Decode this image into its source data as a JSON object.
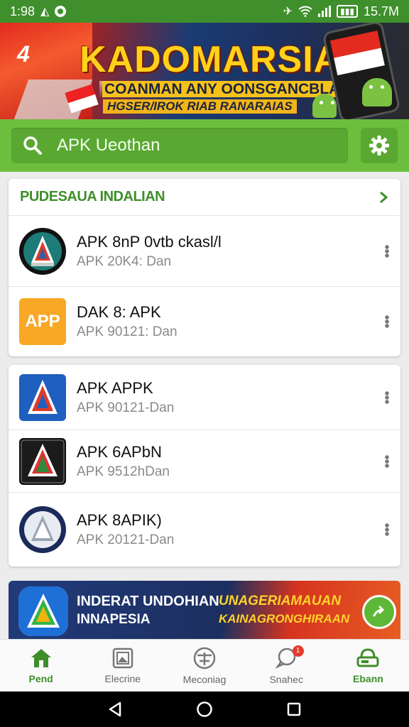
{
  "status_bar": {
    "time": "1:98",
    "right_text": "15.7M",
    "icons": [
      "notification-icon",
      "dot-icon",
      "nfc-icon",
      "wifi-icon",
      "signal-icon",
      "battery-icon"
    ]
  },
  "banner": {
    "logo_mark": "4",
    "title": "KADOMARSIA",
    "line1": "COANMAN ANY OONSGANCBLAS",
    "line2": "HGSER/IROK RIAB RANARAIAS"
  },
  "search": {
    "value": "APK Ueothan",
    "icons": [
      "search-icon",
      "gear-icon"
    ]
  },
  "section1": {
    "title": "PUDESAUA INDALIAN",
    "items": [
      {
        "name": "APK 8nP 0vtb ckasl/l",
        "meta": "APK  20K4: Dan",
        "icon": "apk-logo-dark-circle"
      },
      {
        "name": "DAK 8: APK",
        "meta": "APK  90121: Dan",
        "icon_text": "APP",
        "icon": "app-orange-square"
      }
    ]
  },
  "section2": {
    "items": [
      {
        "name": "APK APPK",
        "meta": "APK  90121-Dan",
        "icon": "apk-logo-blue-square"
      },
      {
        "name": "APK 6APbN",
        "meta": "APK  9512hDan",
        "icon": "apk-logo-black-square"
      },
      {
        "name": "APK 8APIK)",
        "meta": "APK  20121-Dan",
        "icon": "apk-logo-navy-circle"
      }
    ]
  },
  "promo": {
    "left_line1": "INDERAT UNDOHIAN",
    "left_line2": "INNAPESIA",
    "right_line1": "UNAGERIAMAUAN",
    "right_line2": "KAINAGRONGHIRAAN"
  },
  "bottom_nav": {
    "items": [
      {
        "label": "Pend",
        "icon": "home-icon"
      },
      {
        "label": "Elecrine",
        "icon": "image-icon"
      },
      {
        "label": "Meconiag",
        "icon": "globe-icon"
      },
      {
        "label": "Snahec",
        "icon": "chat-icon",
        "badge": "1"
      },
      {
        "label": "Ebann",
        "icon": "drive-icon"
      }
    ]
  },
  "colors": {
    "primary_green": "#6cbf3d",
    "dark_green": "#3e8e2a",
    "status_green": "#3f8f2c"
  }
}
